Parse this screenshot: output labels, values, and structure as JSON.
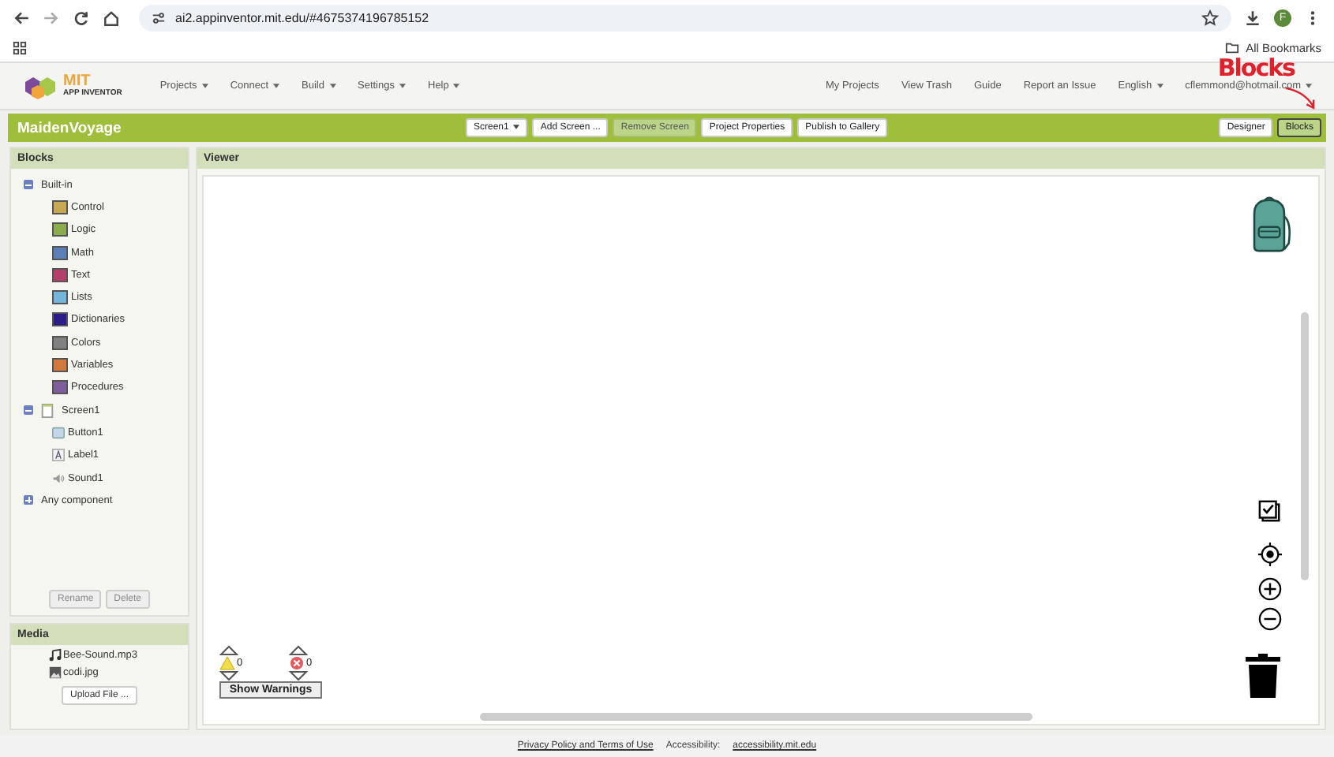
{
  "browser": {
    "url": "ai2.appinventor.mit.edu/#4675374196785152",
    "profile_initial": "F",
    "bookmarks": "All Bookmarks"
  },
  "header": {
    "logo_title": "MIT",
    "logo_subtitle": "APP INVENTOR",
    "menus": [
      {
        "label": "Projects",
        "dropdown": true
      },
      {
        "label": "Connect",
        "dropdown": true
      },
      {
        "label": "Build",
        "dropdown": true
      },
      {
        "label": "Settings",
        "dropdown": true
      },
      {
        "label": "Help",
        "dropdown": true
      }
    ],
    "links": [
      {
        "label": "My Projects",
        "dropdown": false
      },
      {
        "label": "View Trash",
        "dropdown": false
      },
      {
        "label": "Guide",
        "dropdown": false
      },
      {
        "label": "Report an Issue",
        "dropdown": false
      },
      {
        "label": "English",
        "dropdown": true
      },
      {
        "label": "cflemmond@hotmail.com",
        "dropdown": true
      }
    ]
  },
  "project_bar": {
    "name": "MaidenVoyage",
    "buttons": [
      {
        "label": "Screen1",
        "dropdown": true,
        "disabled": false
      },
      {
        "label": "Add Screen ...",
        "dropdown": false,
        "disabled": false
      },
      {
        "label": "Remove Screen",
        "dropdown": false,
        "disabled": true
      },
      {
        "label": "Project Properties",
        "dropdown": false,
        "disabled": false
      },
      {
        "label": "Publish to Gallery",
        "dropdown": false,
        "disabled": false
      }
    ],
    "views": [
      {
        "label": "Designer",
        "selected": false
      },
      {
        "label": "Blocks",
        "selected": true
      }
    ]
  },
  "annotation": {
    "text": "Blocks"
  },
  "blocks_panel": {
    "title": "Blocks",
    "tree": [
      {
        "label": "Built-in",
        "expanded": true,
        "children": [
          {
            "label": "Control",
            "color": "#c8a850"
          },
          {
            "label": "Logic",
            "color": "#8cad4f"
          },
          {
            "label": "Math",
            "color": "#5b80b8"
          },
          {
            "label": "Text",
            "color": "#b3406a"
          },
          {
            "label": "Lists",
            "color": "#74b4dd"
          },
          {
            "label": "Dictionaries",
            "color": "#2b1d8a"
          },
          {
            "label": "Colors",
            "color": "#808080"
          },
          {
            "label": "Variables",
            "color": "#d17a3c"
          },
          {
            "label": "Procedures",
            "color": "#7f5f9a"
          }
        ]
      },
      {
        "label": "Screen1",
        "expanded": true,
        "children": [
          {
            "label": "Button1",
            "kind": "button"
          },
          {
            "label": "Label1",
            "kind": "label"
          },
          {
            "label": "Sound1",
            "kind": "sound"
          }
        ]
      },
      {
        "label": "Any component",
        "expanded": false
      }
    ],
    "buttons": [
      {
        "label": "Rename",
        "disabled": true
      },
      {
        "label": "Delete",
        "disabled": true
      }
    ]
  },
  "media_panel": {
    "title": "Media",
    "files": [
      {
        "name": "Bee-Sound.mp3",
        "kind": "audio"
      },
      {
        "name": "codi.jpg",
        "kind": "image"
      }
    ],
    "upload_button": "Upload File ..."
  },
  "viewer": {
    "title": "Viewer",
    "warnings": "0",
    "errors": "0",
    "show_warnings_button": "Show Warnings"
  },
  "footer": {
    "link": "Privacy Policy and Terms of Use",
    "accessibility_label": "Accessibility:",
    "accessibility_link": "accessibility.mit.edu"
  }
}
